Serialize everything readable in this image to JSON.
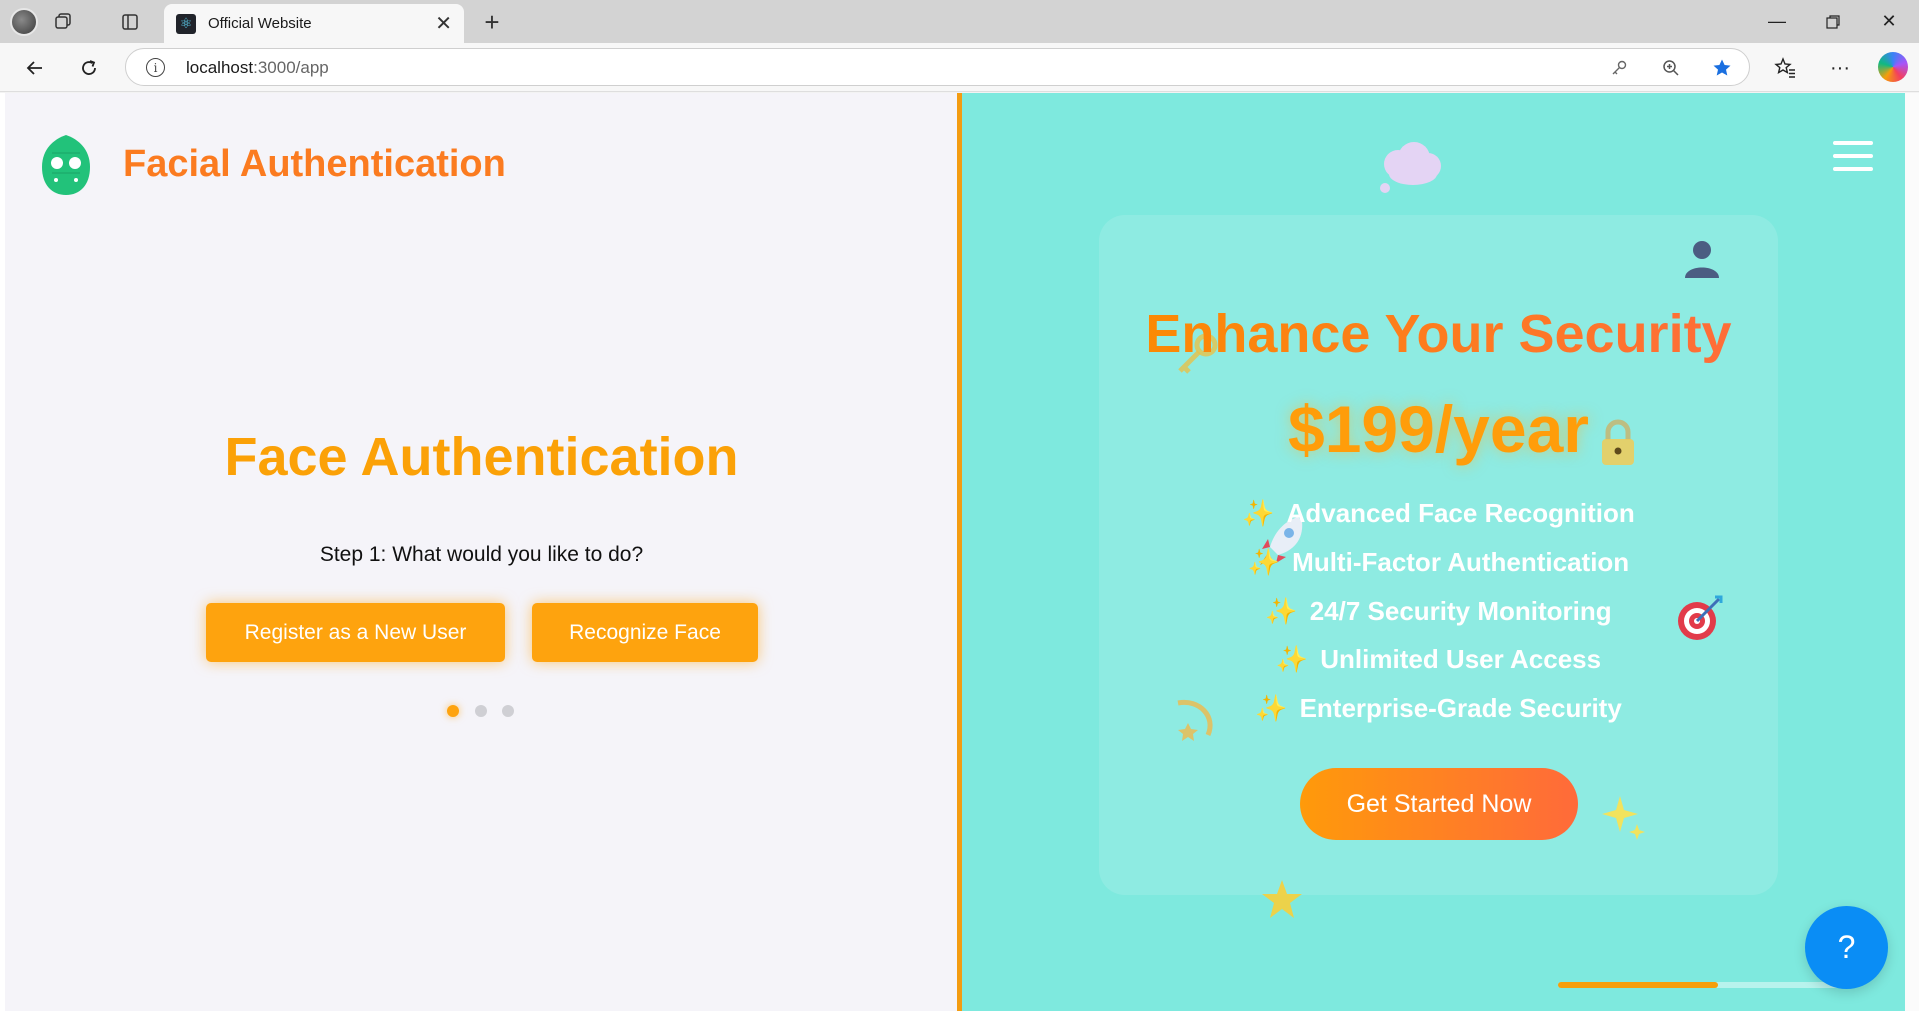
{
  "browser": {
    "tab_title": "Official Website",
    "new_tab_glyph": "+",
    "close_glyph": "✕",
    "url_host": "localhost",
    "url_rest": ":3000/app",
    "icons": [
      "avatar-icon",
      "workspaces-icon",
      "tab-actions-icon",
      "back-icon",
      "refresh-icon",
      "info-icon",
      "key-icon",
      "zoom-icon",
      "favorite-star-icon",
      "favorites-icon",
      "more-icon",
      "copilot-icon"
    ]
  },
  "left": {
    "brand": "Facial Authentication",
    "title": "Face Authentication",
    "step": "Step 1: What would you like to do?",
    "register_label": "Register as a New User",
    "recognize_label": "Recognize Face",
    "carousel_active_index": 0,
    "carousel_count": 3
  },
  "right": {
    "title": "Enhance Your Security",
    "price": "$199/year",
    "features": [
      "Advanced Face Recognition",
      "Multi-Factor Authentication",
      "24/7 Security Monitoring",
      "Unlimited User Access",
      "Enterprise-Grade Security"
    ],
    "feature_glyph": "✨",
    "cta_label": "Get Started Now",
    "help_label": "?",
    "progress": 0.55
  },
  "colors": {
    "accent_orange": "#fea30e",
    "brand_orange": "#fb7b20",
    "panel_teal": "#7ee9de",
    "help_blue": "#0a8df5"
  }
}
